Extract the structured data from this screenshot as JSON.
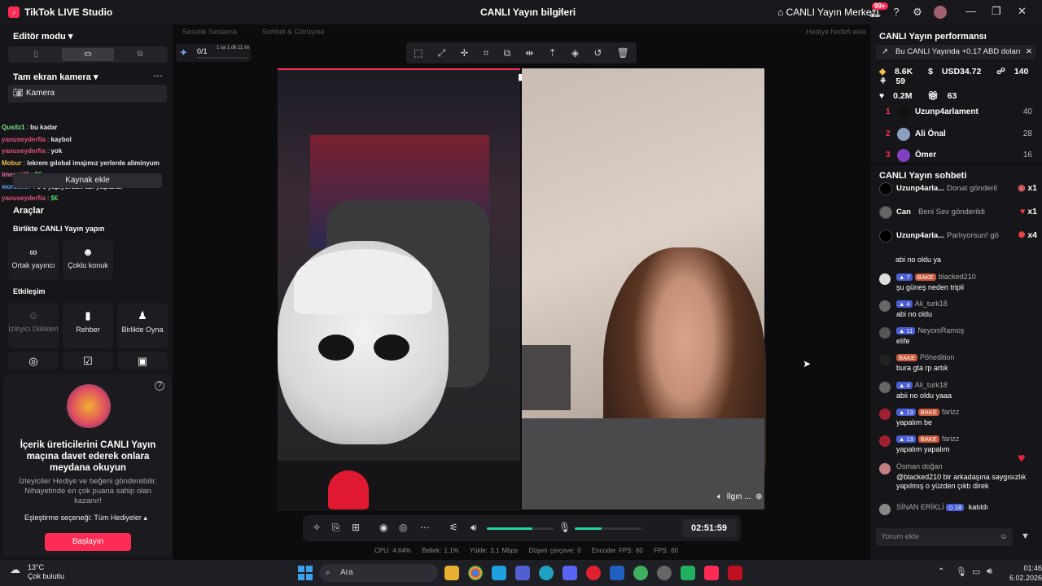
{
  "app": {
    "title": "TikTok LIVE Studio",
    "logo_letter": "♪"
  },
  "topbar": {
    "center_title": "CANLI Yayın bilgileri",
    "merkez_label": "CANLI Yayın Merkezi",
    "notif_badge": "99+"
  },
  "left": {
    "editor_mode": "Editör modu",
    "full_screen_camera": "Tam ekran kamera",
    "camera_label": "Kamera",
    "kaynak_ekle": "Kaynak ekle",
    "tools_title": "Araçlar",
    "birlikte_title": "Birlikte CANLI Yayın yapın",
    "etkilesim_title": "Etkileşim",
    "tools": [
      {
        "label": "Ortak yayıncı",
        "icon": "∞"
      },
      {
        "label": "Çoklu konuk",
        "icon": "☻"
      }
    ],
    "interaction": [
      {
        "label": "İzleyici Dilekleri",
        "icon": "☺"
      },
      {
        "label": "Rehber",
        "icon": "▮"
      },
      {
        "label": "Birlikte Oyna",
        "icon": "♟"
      }
    ],
    "chat_overlay": [
      {
        "user": "Qusilz1",
        "text": "bu kadar",
        "color": "#7fe07f"
      },
      {
        "user": "yanuseyderfia",
        "text": "kaybol",
        "color": "#e0507a"
      },
      {
        "user": "yanuseyderfia",
        "text": "yok",
        "color": "#e0507a"
      },
      {
        "user": "Mobur",
        "text": "lekrem gılobal imajımız yerlerde aliminyum",
        "color": "#f0c040"
      },
      {
        "user": "lmesai40",
        "text": "$€",
        "color": "#e070a0"
      },
      {
        "user": "wordex57",
        "text": "5 6 yapıyordun abi yaşlandı",
        "color": "#60a0f0"
      },
      {
        "user": "yanuseyderfia",
        "text": "$€",
        "color": "#e0507a"
      }
    ],
    "invite": {
      "title": "İçerik üreticilerini CANLI Yayın maçına davet ederek onlara meydana okuyun",
      "desc": "İzleyiciler Hediye ve beğeni gönderebilir. Nihayetinde en çok puana sahip olan kazanır!",
      "eslesme": "Eşleştirme seçeneği: Tüm Hediyeler ▴",
      "start": "Başlayın"
    }
  },
  "center": {
    "ghost_tabs": [
      "Sesetik Seslama",
      "Sohbet & Görüşme",
      "Hediye hedefi ekle"
    ],
    "progress": "0/1",
    "progress_sub": "1 sa 1 dk 11 sn",
    "cam_caption": "Ilgın ...",
    "timer": "02:51:59",
    "stats": [
      "CPU: 4.64%",
      "Bellek: 1.1%",
      "Yükle: 3.1 Mbps",
      "Düşen çerçeve: 0",
      "Encoder FPS: 60",
      "FPS: 60"
    ],
    "volume_level": 0.68,
    "mic_level": 0.4
  },
  "right": {
    "perf_title": "CANLI Yayın performansı",
    "info_text": "Bu CANLI Yayında +0.17 ABD doları",
    "kpis": [
      "8.6K",
      "USD34.72",
      "140",
      "59",
      "0.2M",
      "63"
    ],
    "ranking": [
      {
        "rank": "1",
        "name": "Uzunp4arlament",
        "score": "40"
      },
      {
        "rank": "2",
        "name": "Ali Önal",
        "score": "28"
      },
      {
        "rank": "3",
        "name": "Ömer",
        "score": "16"
      }
    ],
    "chat_title": "CANLI Yayın sohbeti",
    "gifts": [
      {
        "name": "Uzunp4arla...",
        "text": "Donat gönderil",
        "count": "x1"
      },
      {
        "name": "Can",
        "text": "Beni Sev gönderildi",
        "count": "x1"
      },
      {
        "name": "Uzunp4arla...",
        "text": "Parlıyorsun! gö",
        "count": "x4"
      }
    ],
    "partial_line": "abi no oldu ya",
    "messages": [
      {
        "lvl": "7",
        "bake": "BAKE",
        "user": "blacked210",
        "text": "şu güneş neden tripli"
      },
      {
        "lvl": "4",
        "bake": "",
        "user": "Ali_turk18",
        "text": "abi no oldu"
      },
      {
        "lvl": "11",
        "bake": "",
        "user": "NeyomRamoş",
        "text": "elife"
      },
      {
        "lvl": "",
        "bake": "BAKE",
        "user": "Pöhedition",
        "text": "bura gta rp artık"
      },
      {
        "lvl": "4",
        "bake": "",
        "user": "Ali_turk18",
        "text": "abii no oldu yaaa"
      },
      {
        "lvl": "13",
        "bake": "BAKE",
        "user": "farizz",
        "text": "yapalım be"
      },
      {
        "lvl": "13",
        "bake": "BAKE",
        "user": "farizz",
        "text": "yapalım yapalım"
      },
      {
        "lvl": "",
        "bake": "",
        "user": "Osman doğan",
        "text": "@blacked210 bir arkadaşına saygısızlık yapılmış o yüzden çıktı direk"
      },
      {
        "lvl": "18",
        "bake": "",
        "user": "SİNAN ERİKLİ",
        "text": "katıldı"
      }
    ],
    "comment_placeholder": "Yorum ekle"
  },
  "taskbar": {
    "weather_temp": "13°C",
    "weather_desc": "Çok bulutlu",
    "search_label": "Ara",
    "time": "01:46",
    "date": "6.02.2026"
  },
  "colors": {
    "accent": "#fe2c55",
    "level": "#25d4a0"
  }
}
